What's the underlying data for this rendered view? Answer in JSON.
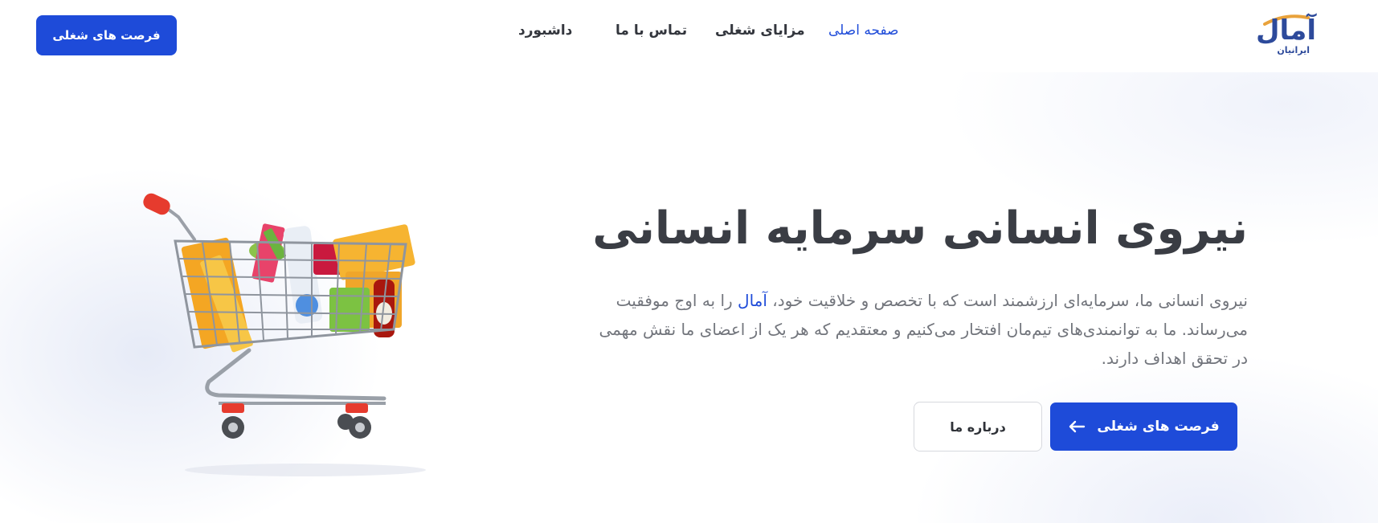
{
  "header": {
    "cta_label": "فرصت های شغلی",
    "nav": [
      {
        "label": "صفحه اصلی",
        "active": true
      },
      {
        "label": "مزایای شغلی",
        "active": false
      },
      {
        "label": "تماس با ما",
        "active": false
      },
      {
        "label": "داشبورد",
        "active": false
      }
    ],
    "logo_text": "آمال",
    "logo_subtext": "ایرانیان"
  },
  "hero": {
    "title": "نیروی انسانی سرمایه انسانی",
    "desc_part1": "نیروی انسانی ما، سرمایه‌ای ارزشمند است که با تخصص و خلاقیت خود، ",
    "desc_brand": "آمال",
    "desc_part2": " را به اوج موفقیت می‌رساند. ما به توانمندی‌های تیم‌مان افتخار می‌کنیم و معتقدیم که هر یک از اعضای ما نقش مهمی در تحقق اهداف دارند.",
    "primary_button": "فرصت های شغلی",
    "secondary_button": "درباره ما",
    "illustration": "shopping-cart-illustration"
  },
  "colors": {
    "accent": "#1e4bd9",
    "text_dark": "#3a3d44",
    "text_muted": "#72757c",
    "logo": "#2d4a9b"
  }
}
